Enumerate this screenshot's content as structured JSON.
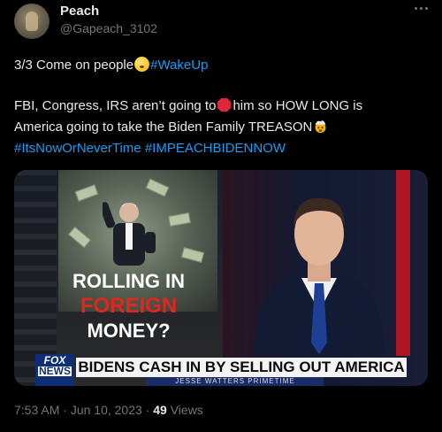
{
  "author": {
    "display_name": "Peach",
    "handle": "@Gapeach_3102"
  },
  "tweet": {
    "line1_text": "3/3 Come on people",
    "line1_hashtag": "#WakeUp",
    "line2_before": "FBI, Congress, IRS aren’t going to",
    "line2_after": "him so HOW LONG is",
    "line3_text": "America going to take the Biden Family TREASON",
    "line4_hashtag1": "#ItsNowOrNeverTime",
    "line4_hashtag2": "#IMPEACHBIDENNOW"
  },
  "media": {
    "headline_line1": "ROLLING IN",
    "headline_line2": "FOREIGN",
    "headline_line3": "MONEY?",
    "chyron_text": "BIDENS CASH IN BY SELLING OUT AMERICA",
    "chyron_subtext": "JESSE WATTERS PRIMETIME",
    "network_logo_line1": "FOX",
    "network_logo_line2": "NEWS"
  },
  "footer": {
    "time": "7:53 AM",
    "separator1": " · ",
    "date": "Jun 10, 2023",
    "separator2": " · ",
    "views_count": "49",
    "views_label": " Views"
  },
  "icons": {
    "more": "more-horizontal-icon",
    "thinking_emoji": "thinking-face-emoji",
    "stop_emoji": "stop-sign-emoji",
    "exploding_emoji": "exploding-head-emoji"
  },
  "colors": {
    "background": "#000000",
    "text": "#e7e9ea",
    "secondary": "#71767b",
    "link": "#1d9bf0",
    "headline_red": "#e3261b"
  }
}
